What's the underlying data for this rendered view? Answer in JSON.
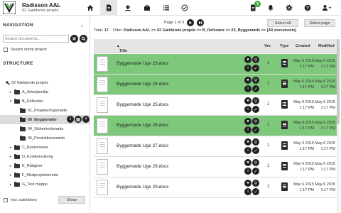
{
  "header": {
    "title": "Radisson AAL",
    "subtitle": "02 Gældende projekt",
    "notification_count": "3",
    "nav_icons": [
      "home-icon",
      "document-icon",
      "upload-icon",
      "briefcase-icon",
      "list-icon",
      "checkmark-icon",
      "report-icon",
      "bell-icon",
      "gear-icon",
      "help-icon",
      "user-icon"
    ]
  },
  "sidebar": {
    "navigation_title": "NAVIGATION",
    "search_placeholder": "Search documents...",
    "search_entire_label": "Search entire project",
    "structure_title": "STRUCTURE",
    "tree": [
      {
        "label": "02 Gældende projekt",
        "level": 0,
        "expanded": true
      },
      {
        "label": "A_Arbejdsmiljø",
        "level": 1,
        "expanded": false
      },
      {
        "label": "B_Referater",
        "level": 1,
        "expanded": true
      },
      {
        "label": "01_Projekteringsmøde",
        "level": 2,
        "expanded": false
      },
      {
        "label": "03_Byggemøde",
        "level": 2,
        "expanded": false,
        "selected": true
      },
      {
        "label": "04_Sikkerhedsmøde",
        "level": 2,
        "expanded": false
      },
      {
        "label": "05_Produktionsmøde",
        "level": 2,
        "expanded": false
      },
      {
        "label": "C_Beskrivelser",
        "level": 1,
        "expanded": false
      },
      {
        "label": "D_Kvalitetssikring",
        "level": 1,
        "expanded": false
      },
      {
        "label": "E_Rådgiver",
        "level": 1,
        "expanded": false
      },
      {
        "label": "F_Medprojekterende",
        "level": 1,
        "expanded": false
      },
      {
        "label": "G_Test mappe",
        "level": 1,
        "expanded": false
      }
    ],
    "incl_subfolders_label": "Incl. subfolders",
    "show_button": "Show"
  },
  "main": {
    "page_label": "Page 1 of 3",
    "select_all": "Select all",
    "select_page": "Select page",
    "total_label": "Total:",
    "total_value": "17",
    "filter_label": "Filter:",
    "filter_value": "Radisson AAL >> 02 Gældende projekt >> B_Referater >> 03_Byggemøde >> [All documents]",
    "columns": {
      "title": "Title",
      "ver": "Ver.",
      "type": "Type",
      "created": "Created",
      "modified": "Modified"
    },
    "rows": [
      {
        "name": "Byggemøde Uge 23.docx",
        "ver": "1",
        "created_date": "May 6 2015",
        "created_time": "1:17 PM",
        "modified_date": "May 6 2015",
        "modified_time": "1:17 PM",
        "highlight": true
      },
      {
        "name": "Byggemøde Uge 24.docx",
        "ver": "1",
        "created_date": "May 6 2015",
        "created_time": "1:17 PM",
        "modified_date": "May 6 2015",
        "modified_time": "1:17 PM",
        "highlight": true
      },
      {
        "name": "Byggemøde Uge 25.docx",
        "ver": "1",
        "created_date": "May 6 2015",
        "created_time": "1:17 PM",
        "modified_date": "May 6 2015",
        "modified_time": "1:17 PM",
        "highlight": false
      },
      {
        "name": "Byggemøde Uge 26.docx",
        "ver": "1",
        "created_date": "May 6 2015",
        "created_time": "1:17 PM",
        "modified_date": "May 6 2015",
        "modified_time": "1:17 PM",
        "highlight": true
      },
      {
        "name": "Byggemøde Uge 27.docx",
        "ver": "1",
        "created_date": "May 6 2015",
        "created_time": "1:17 PM",
        "modified_date": "May 6 2015",
        "modified_time": "1:17 PM",
        "highlight": false
      },
      {
        "name": "Byggemøde Uge 28.docx",
        "ver": "1",
        "created_date": "May 6 2015",
        "created_time": "1:17 PM",
        "modified_date": "May 6 2015",
        "modified_time": "1:17 PM",
        "highlight": false
      },
      {
        "name": "Byggemøde Uge 29.docx",
        "ver": "1",
        "created_date": "May 6 2015",
        "created_time": "1:17 PM",
        "modified_date": "May 6 2015",
        "modified_time": "1:17 PM",
        "highlight": false
      }
    ]
  },
  "colors": {
    "highlight_row": "#7dc87a",
    "badge": "#3aa935",
    "selected_tree": "#dcdcdc"
  }
}
